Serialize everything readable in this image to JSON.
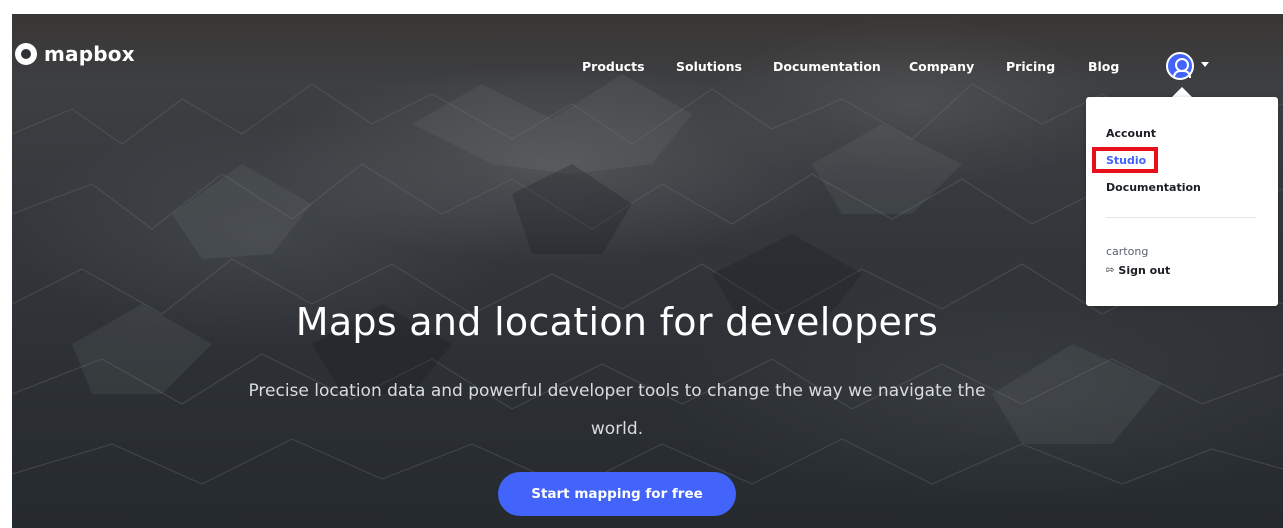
{
  "brand": {
    "logo_text": "mapbox"
  },
  "nav": {
    "items": [
      {
        "label": "Products"
      },
      {
        "label": "Solutions"
      },
      {
        "label": "Documentation"
      },
      {
        "label": "Company"
      },
      {
        "label": "Pricing"
      },
      {
        "label": "Blog"
      }
    ]
  },
  "account_menu": {
    "items": [
      {
        "label": "Account",
        "active": false
      },
      {
        "label": "Studio",
        "active": true
      },
      {
        "label": "Documentation",
        "active": false
      }
    ],
    "username": "cartong",
    "signout_label": "Sign out",
    "signout_icon": "sign-out-icon"
  },
  "hero": {
    "title": "Maps and location for developers",
    "subtitle": "Precise location data and powerful developer tools to change the way we navigate the world.",
    "cta_label": "Start mapping for free"
  },
  "colors": {
    "accent": "#4264fb",
    "highlight": "#e8101a",
    "text_dark": "#1b1f24"
  }
}
